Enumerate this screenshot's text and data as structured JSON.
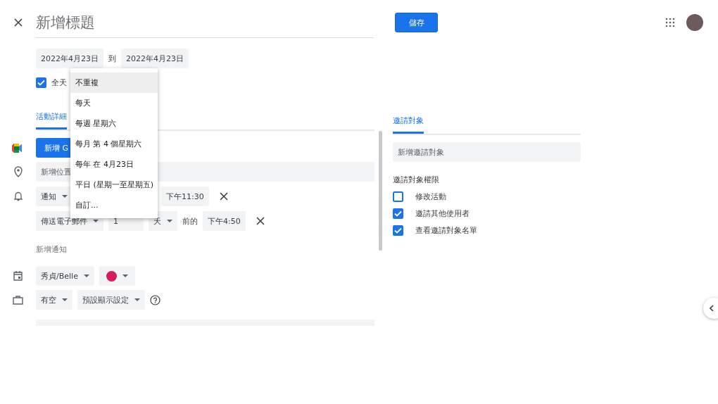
{
  "header": {
    "title_placeholder": "新增標題",
    "save_button": "儲存"
  },
  "date_range": {
    "start": "2022年4月23日",
    "separator": "到",
    "end": "2022年4月23日"
  },
  "all_day": {
    "label": "全天",
    "checked": true
  },
  "repeat_menu": {
    "items": [
      {
        "label": "不重複",
        "selected": true
      },
      {
        "label": "每天",
        "selected": false
      },
      {
        "label": "每週 星期六",
        "selected": false
      },
      {
        "label": "每月 第 4 個星期六",
        "selected": false
      },
      {
        "label": "每年 在 4月23日",
        "selected": false
      },
      {
        "label": "平日 (星期一至星期五)",
        "selected": false
      },
      {
        "label": "自訂...",
        "selected": false
      }
    ]
  },
  "details": {
    "tab": {
      "label": "活動詳細",
      "selected": true
    },
    "meet_button": "新增 G",
    "location_placeholder": "新增位置",
    "notifications": [
      {
        "method": "通知",
        "time": "下午11:30"
      },
      {
        "method": "傳送電子郵件",
        "amount": "1",
        "unit": "天",
        "relation": "前的",
        "time": "下午4:50"
      }
    ],
    "add_notification": "新增通知",
    "calendar": {
      "name": "秀貞/Belle",
      "color": "#d81b60"
    },
    "availability": "有空",
    "visibility": "預設顯示設定"
  },
  "guests": {
    "tab": {
      "label": "邀請對象",
      "selected": true
    },
    "placeholder": "新增邀請對象",
    "permissions_title": "邀請對象權限",
    "permissions": [
      {
        "label": "修改活動",
        "checked": false
      },
      {
        "label": "邀請其他使用者",
        "checked": true
      },
      {
        "label": "查看邀請對象名單",
        "checked": true
      }
    ]
  }
}
